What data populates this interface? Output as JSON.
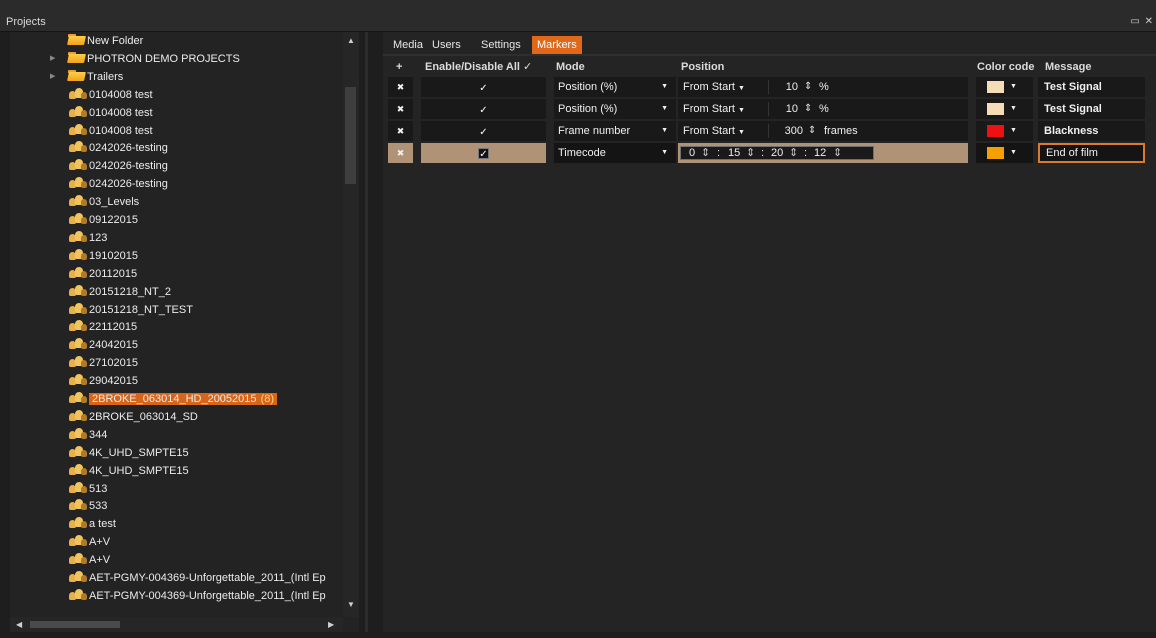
{
  "window": {
    "title": "Projects",
    "controls": "▭ ✕"
  },
  "tree": {
    "items": [
      {
        "label": "New Folder",
        "type": "folder",
        "expander": false
      },
      {
        "label": "PHOTRON DEMO PROJECTS",
        "type": "folder",
        "expander": true
      },
      {
        "label": "Trailers",
        "type": "folder",
        "expander": true
      },
      {
        "label": "0104008 test",
        "type": "project"
      },
      {
        "label": "0104008 test",
        "type": "project"
      },
      {
        "label": "0104008 test",
        "type": "project"
      },
      {
        "label": "0242026-testing",
        "type": "project"
      },
      {
        "label": "0242026-testing",
        "type": "project"
      },
      {
        "label": "0242026-testing",
        "type": "project"
      },
      {
        "label": "03_Levels",
        "type": "project"
      },
      {
        "label": "09122015",
        "type": "project"
      },
      {
        "label": "123",
        "type": "project"
      },
      {
        "label": "19102015",
        "type": "project"
      },
      {
        "label": "20112015",
        "type": "project"
      },
      {
        "label": "20151218_NT_2",
        "type": "project"
      },
      {
        "label": "20151218_NT_TEST",
        "type": "project"
      },
      {
        "label": "22112015",
        "type": "project"
      },
      {
        "label": "24042015",
        "type": "project"
      },
      {
        "label": "27102015",
        "type": "project"
      },
      {
        "label": "29042015",
        "type": "project"
      },
      {
        "label": "2BROKE_063014_HD_20052015",
        "type": "project",
        "selected": true,
        "count": "(8)"
      },
      {
        "label": "2BROKE_063014_SD",
        "type": "project"
      },
      {
        "label": "344",
        "type": "project"
      },
      {
        "label": "4K_UHD_SMPTE15",
        "type": "project"
      },
      {
        "label": "4K_UHD_SMPTE15",
        "type": "project"
      },
      {
        "label": "513",
        "type": "project"
      },
      {
        "label": "533",
        "type": "project"
      },
      {
        "label": "a test",
        "type": "project"
      },
      {
        "label": "A+V",
        "type": "project"
      },
      {
        "label": "A+V",
        "type": "project"
      },
      {
        "label": "AET-PGMY-004369-Unforgettable_2011_(Intl Ep",
        "type": "project"
      },
      {
        "label": "AET-PGMY-004369-Unforgettable_2011_(Intl Ep",
        "type": "project"
      }
    ]
  },
  "tabs": [
    {
      "label": "Media",
      "active": false
    },
    {
      "label": "Users",
      "active": false
    },
    {
      "label": "Settings",
      "active": false
    },
    {
      "label": "Markers",
      "active": true
    }
  ],
  "markers": {
    "headers": {
      "add": "+",
      "enable_all": "Enable/Disable All ✓",
      "mode": "Mode",
      "position": "Position",
      "color": "Color code",
      "message": "Message"
    },
    "rows": [
      {
        "enabled": "✓",
        "mode": "Position (%)",
        "from": "From Start",
        "value": "10",
        "unit": "%",
        "color": "#f3dcb6",
        "message": "Test Signal"
      },
      {
        "enabled": "✓",
        "mode": "Position (%)",
        "from": "From Start",
        "value": "10",
        "unit": "%",
        "color": "#f3dcb6",
        "message": "Test Signal"
      },
      {
        "enabled": "✓",
        "mode": "Frame number",
        "from": "From Start",
        "value": "300",
        "unit": "frames",
        "color": "#ee1111",
        "message": "Blackness"
      },
      {
        "enabled": "✓",
        "mode": "Timecode",
        "timecode": [
          "0",
          "15",
          "20",
          "12"
        ],
        "color": "#f5a000",
        "message": "End of film",
        "selected": true
      }
    ]
  },
  "colors": {
    "accent": "#e0681b",
    "selected_row": "#b09277"
  }
}
